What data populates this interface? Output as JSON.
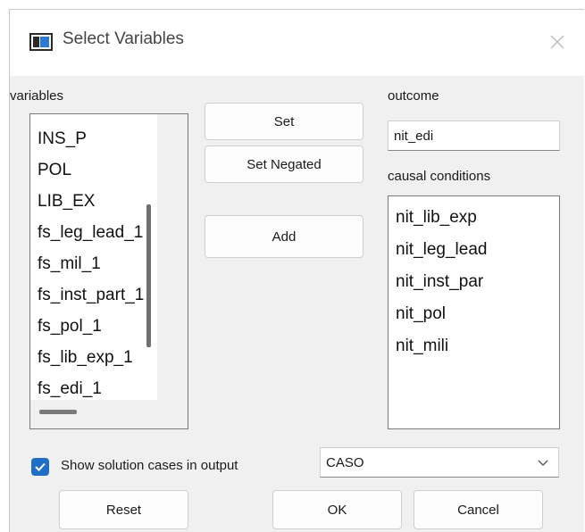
{
  "window": {
    "title": "Select Variables"
  },
  "variables": {
    "label": "variables",
    "items": [
      "INS_P",
      "POL",
      "LIB_EX",
      "fs_leg_lead_1",
      "fs_mil_1",
      "fs_inst_part_1",
      "fs_pol_1",
      "fs_lib_exp_1",
      "fs_edi_1"
    ],
    "selected": "fs_leg_lead_1"
  },
  "buttons": {
    "set": "Set",
    "set_negated": "Set Negated",
    "add": "Add",
    "reset": "Reset",
    "ok": "OK",
    "cancel": "Cancel"
  },
  "outcome": {
    "label": "outcome",
    "value": "nit_edi"
  },
  "causal": {
    "label": "causal conditions",
    "items": [
      "nit_lib_exp",
      "nit_leg_lead",
      "nit_inst_par",
      "nit_pol",
      "nit_mili"
    ]
  },
  "options": {
    "show_cases_label": "Show solution cases in output",
    "show_cases_checked": true,
    "case_select_value": "CASO"
  },
  "colors": {
    "accent": "#1e6fc5"
  }
}
